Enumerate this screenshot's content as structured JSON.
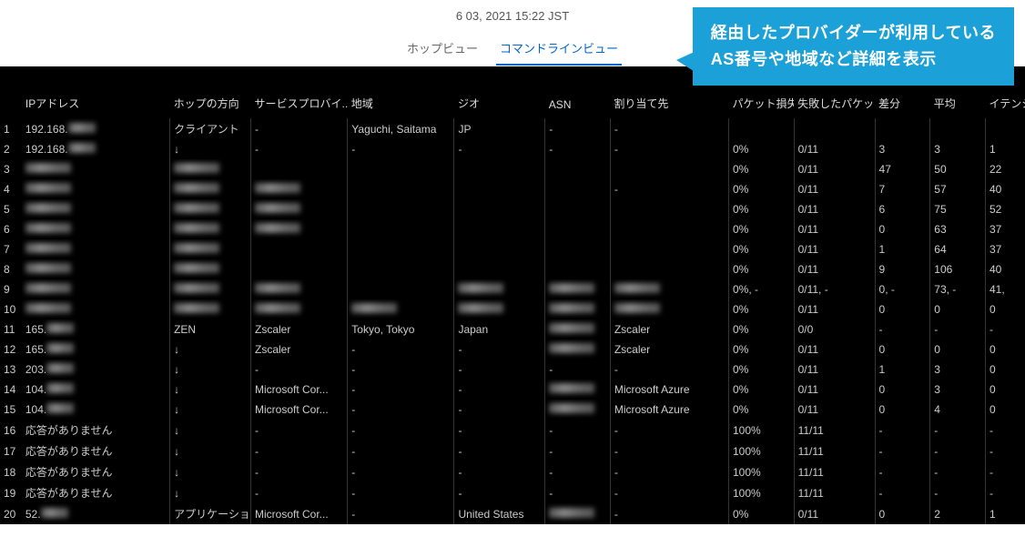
{
  "timestamp": "6 03, 2021 15:22 JST",
  "tabs": {
    "hop": "ホップビュー",
    "cmd": "コマンドラインビュー"
  },
  "callout": {
    "line1": "経由したプロバイダーが利用している",
    "line2": "AS番号や地域など詳細を表示"
  },
  "headers": {
    "ip": "IPアドレス",
    "direction": "ホップの方向",
    "provider": "サービスプロバイ...",
    "region": "地域",
    "geo": "ジオ",
    "asn": "ASN",
    "alloc": "割り当て先",
    "loss": "パケット損失",
    "failed": "失敗したパケッ...",
    "diff": "差分",
    "avg": "平均",
    "latency": "イテンシ ("
  },
  "rows": [
    {
      "idx": "1",
      "ip": "192.168.▮▮▮",
      "dir": "クライアント",
      "prov": "-",
      "reg": "Yaguchi, Saitama",
      "geo": "JP",
      "asn": "-",
      "alloc": "-",
      "loss": "",
      "fail": "",
      "diff": "",
      "avg": "",
      "lat": ""
    },
    {
      "idx": "2",
      "ip": "192.168.▮▮▮",
      "dir": "↓",
      "prov": "-",
      "reg": "-",
      "geo": "-",
      "asn": "-",
      "alloc": "-",
      "loss": "0%",
      "fail": "0/11",
      "diff": "3",
      "avg": "3",
      "lat": "1"
    },
    {
      "idx": "3",
      "ip": "▮",
      "dir": "▮",
      "prov": "",
      "reg": "",
      "geo": "",
      "asn": "",
      "alloc": "",
      "loss": "0%",
      "fail": "0/11",
      "diff": "47",
      "avg": "50",
      "lat": "22"
    },
    {
      "idx": "4",
      "ip": "▮",
      "dir": "▮",
      "prov": "▮",
      "reg": "",
      "geo": "",
      "asn": "",
      "alloc": "-",
      "loss": "0%",
      "fail": "0/11",
      "diff": "7",
      "avg": "57",
      "lat": "40"
    },
    {
      "idx": "5",
      "ip": "▮",
      "dir": "▮",
      "prov": "▮",
      "reg": "",
      "geo": "",
      "asn": "",
      "alloc": "",
      "loss": "0%",
      "fail": "0/11",
      "diff": "6",
      "avg": "75",
      "lat": "52"
    },
    {
      "idx": "6",
      "ip": "▮",
      "dir": "▮",
      "prov": "▮",
      "reg": "",
      "geo": "",
      "asn": "",
      "alloc": "",
      "loss": "0%",
      "fail": "0/11",
      "diff": "0",
      "avg": "63",
      "lat": "37"
    },
    {
      "idx": "7",
      "ip": "▮",
      "dir": "▮",
      "prov": "",
      "reg": "",
      "geo": "",
      "asn": "",
      "alloc": "",
      "loss": "0%",
      "fail": "0/11",
      "diff": "1",
      "avg": "64",
      "lat": "37"
    },
    {
      "idx": "8",
      "ip": "▮",
      "dir": "▮",
      "prov": "",
      "reg": "",
      "geo": "",
      "asn": "",
      "alloc": "",
      "loss": "0%",
      "fail": "0/11",
      "diff": "9",
      "avg": "106",
      "lat": "40"
    },
    {
      "idx": "9",
      "ip": "▮",
      "dir": "▮",
      "prov": "▮",
      "reg": "",
      "geo": "▮",
      "asn": "▮",
      "alloc": "▮",
      "loss": "0%, -",
      "fail": "0/11, -",
      "diff": "0, -",
      "avg": "73, -",
      "lat": "41,"
    },
    {
      "idx": "10",
      "ip": "▮",
      "dir": "▮",
      "prov": "▮",
      "reg": "▮",
      "geo": "▮",
      "asn": "▮",
      "alloc": "▮",
      "loss": "0%",
      "fail": "0/11",
      "diff": "0",
      "avg": "0",
      "lat": "0"
    },
    {
      "idx": "11",
      "ip": "165.▮▮▮",
      "dir": "ZEN",
      "prov": "Zscaler",
      "reg": "Tokyo, Tokyo",
      "geo": "Japan",
      "asn": "▮",
      "alloc": "Zscaler",
      "loss": "0%",
      "fail": "0/0",
      "diff": "-",
      "avg": "-",
      "lat": "-"
    },
    {
      "idx": "12",
      "ip": "165.▮▮▮",
      "dir": "↓",
      "prov": "Zscaler",
      "reg": "-",
      "geo": "-",
      "asn": "▮",
      "alloc": "Zscaler",
      "loss": "0%",
      "fail": "0/11",
      "diff": "0",
      "avg": "0",
      "lat": "0"
    },
    {
      "idx": "13",
      "ip": "203.▮▮▮",
      "dir": "↓",
      "prov": "-",
      "reg": "-",
      "geo": "-",
      "asn": "-",
      "alloc": "-",
      "loss": "0%",
      "fail": "0/11",
      "diff": "1",
      "avg": "3",
      "lat": "0"
    },
    {
      "idx": "14",
      "ip": "104.▮▮▮",
      "dir": "↓",
      "prov": "Microsoft Cor...",
      "reg": "-",
      "geo": "-",
      "asn": "▮",
      "alloc": "Microsoft Azure",
      "loss": "0%",
      "fail": "0/11",
      "diff": "0",
      "avg": "3",
      "lat": "0"
    },
    {
      "idx": "15",
      "ip": "104.▮▮▮",
      "dir": "↓",
      "prov": "Microsoft Cor...",
      "reg": "-",
      "geo": "-",
      "asn": "▮",
      "alloc": "Microsoft Azure",
      "loss": "0%",
      "fail": "0/11",
      "diff": "0",
      "avg": "4",
      "lat": "0"
    },
    {
      "idx": "16",
      "ip": "応答がありません",
      "dir": "↓",
      "prov": "-",
      "reg": "-",
      "geo": "-",
      "asn": "-",
      "alloc": "-",
      "loss": "100%",
      "fail": "11/11",
      "diff": "-",
      "avg": "-",
      "lat": "-"
    },
    {
      "idx": "17",
      "ip": "応答がありません",
      "dir": "↓",
      "prov": "-",
      "reg": "-",
      "geo": "-",
      "asn": "-",
      "alloc": "-",
      "loss": "100%",
      "fail": "11/11",
      "diff": "-",
      "avg": "-",
      "lat": "-"
    },
    {
      "idx": "18",
      "ip": "応答がありません",
      "dir": "↓",
      "prov": "-",
      "reg": "-",
      "geo": "-",
      "asn": "-",
      "alloc": "-",
      "loss": "100%",
      "fail": "11/11",
      "diff": "-",
      "avg": "-",
      "lat": "-"
    },
    {
      "idx": "19",
      "ip": "応答がありません",
      "dir": "↓",
      "prov": "-",
      "reg": "-",
      "geo": "-",
      "asn": "-",
      "alloc": "-",
      "loss": "100%",
      "fail": "11/11",
      "diff": "-",
      "avg": "-",
      "lat": "-"
    },
    {
      "idx": "20",
      "ip": "52.▮▮▮",
      "dir": "アプリケーション",
      "prov": "Microsoft Cor...",
      "reg": "-",
      "geo": "United States",
      "asn": "▮",
      "alloc": "-",
      "loss": "0%",
      "fail": "0/11",
      "diff": "0",
      "avg": "2",
      "lat": "1"
    }
  ]
}
